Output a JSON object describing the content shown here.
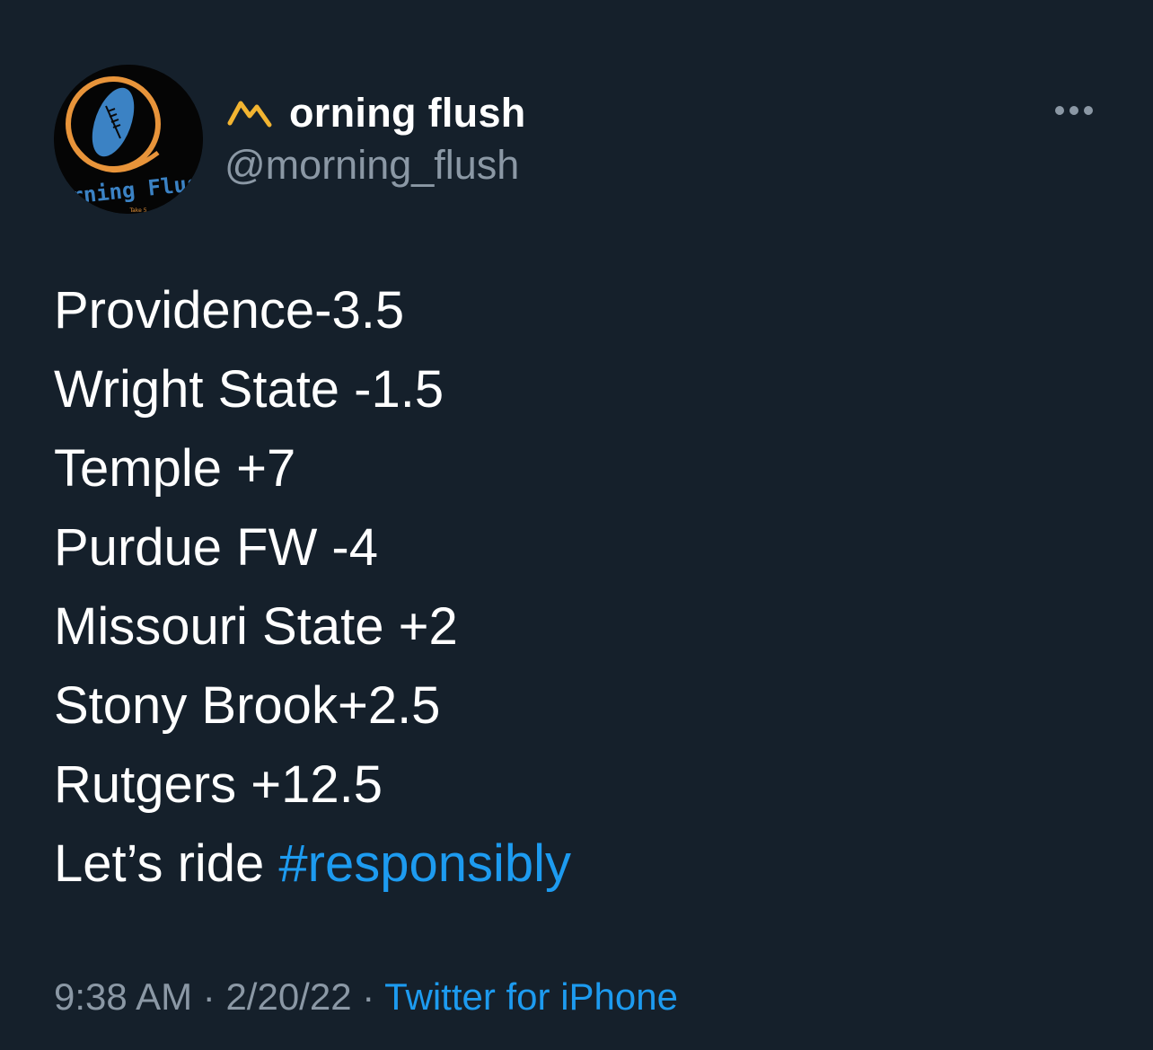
{
  "author": {
    "display_name": "orning flush",
    "handle": "@morning_flush",
    "avatar": {
      "text": "orning Flus",
      "subtext": "Take 5",
      "ring_color": "#e8943a",
      "ball_color": "#3b82c4"
    },
    "name_icon": "mountain-m-icon",
    "name_icon_color": "#f2b431"
  },
  "more_icon": "ellipsis-icon",
  "tweet": {
    "lines": [
      "Providence-3.5",
      "Wright State -1.5",
      "Temple +7",
      "Purdue FW -4",
      "Missouri State +2",
      "Stony Brook+2.5",
      "Rutgers +12.5"
    ],
    "final_prefix": "Let’s ride ",
    "hashtag": "#responsibly"
  },
  "meta": {
    "time": "9:38 AM",
    "separator": " · ",
    "date": "2/20/22",
    "source": "Twitter for iPhone"
  },
  "colors": {
    "background": "#15202b",
    "text": "#ffffff",
    "secondary": "#8b98a5",
    "accent": "#1d9bf0"
  }
}
